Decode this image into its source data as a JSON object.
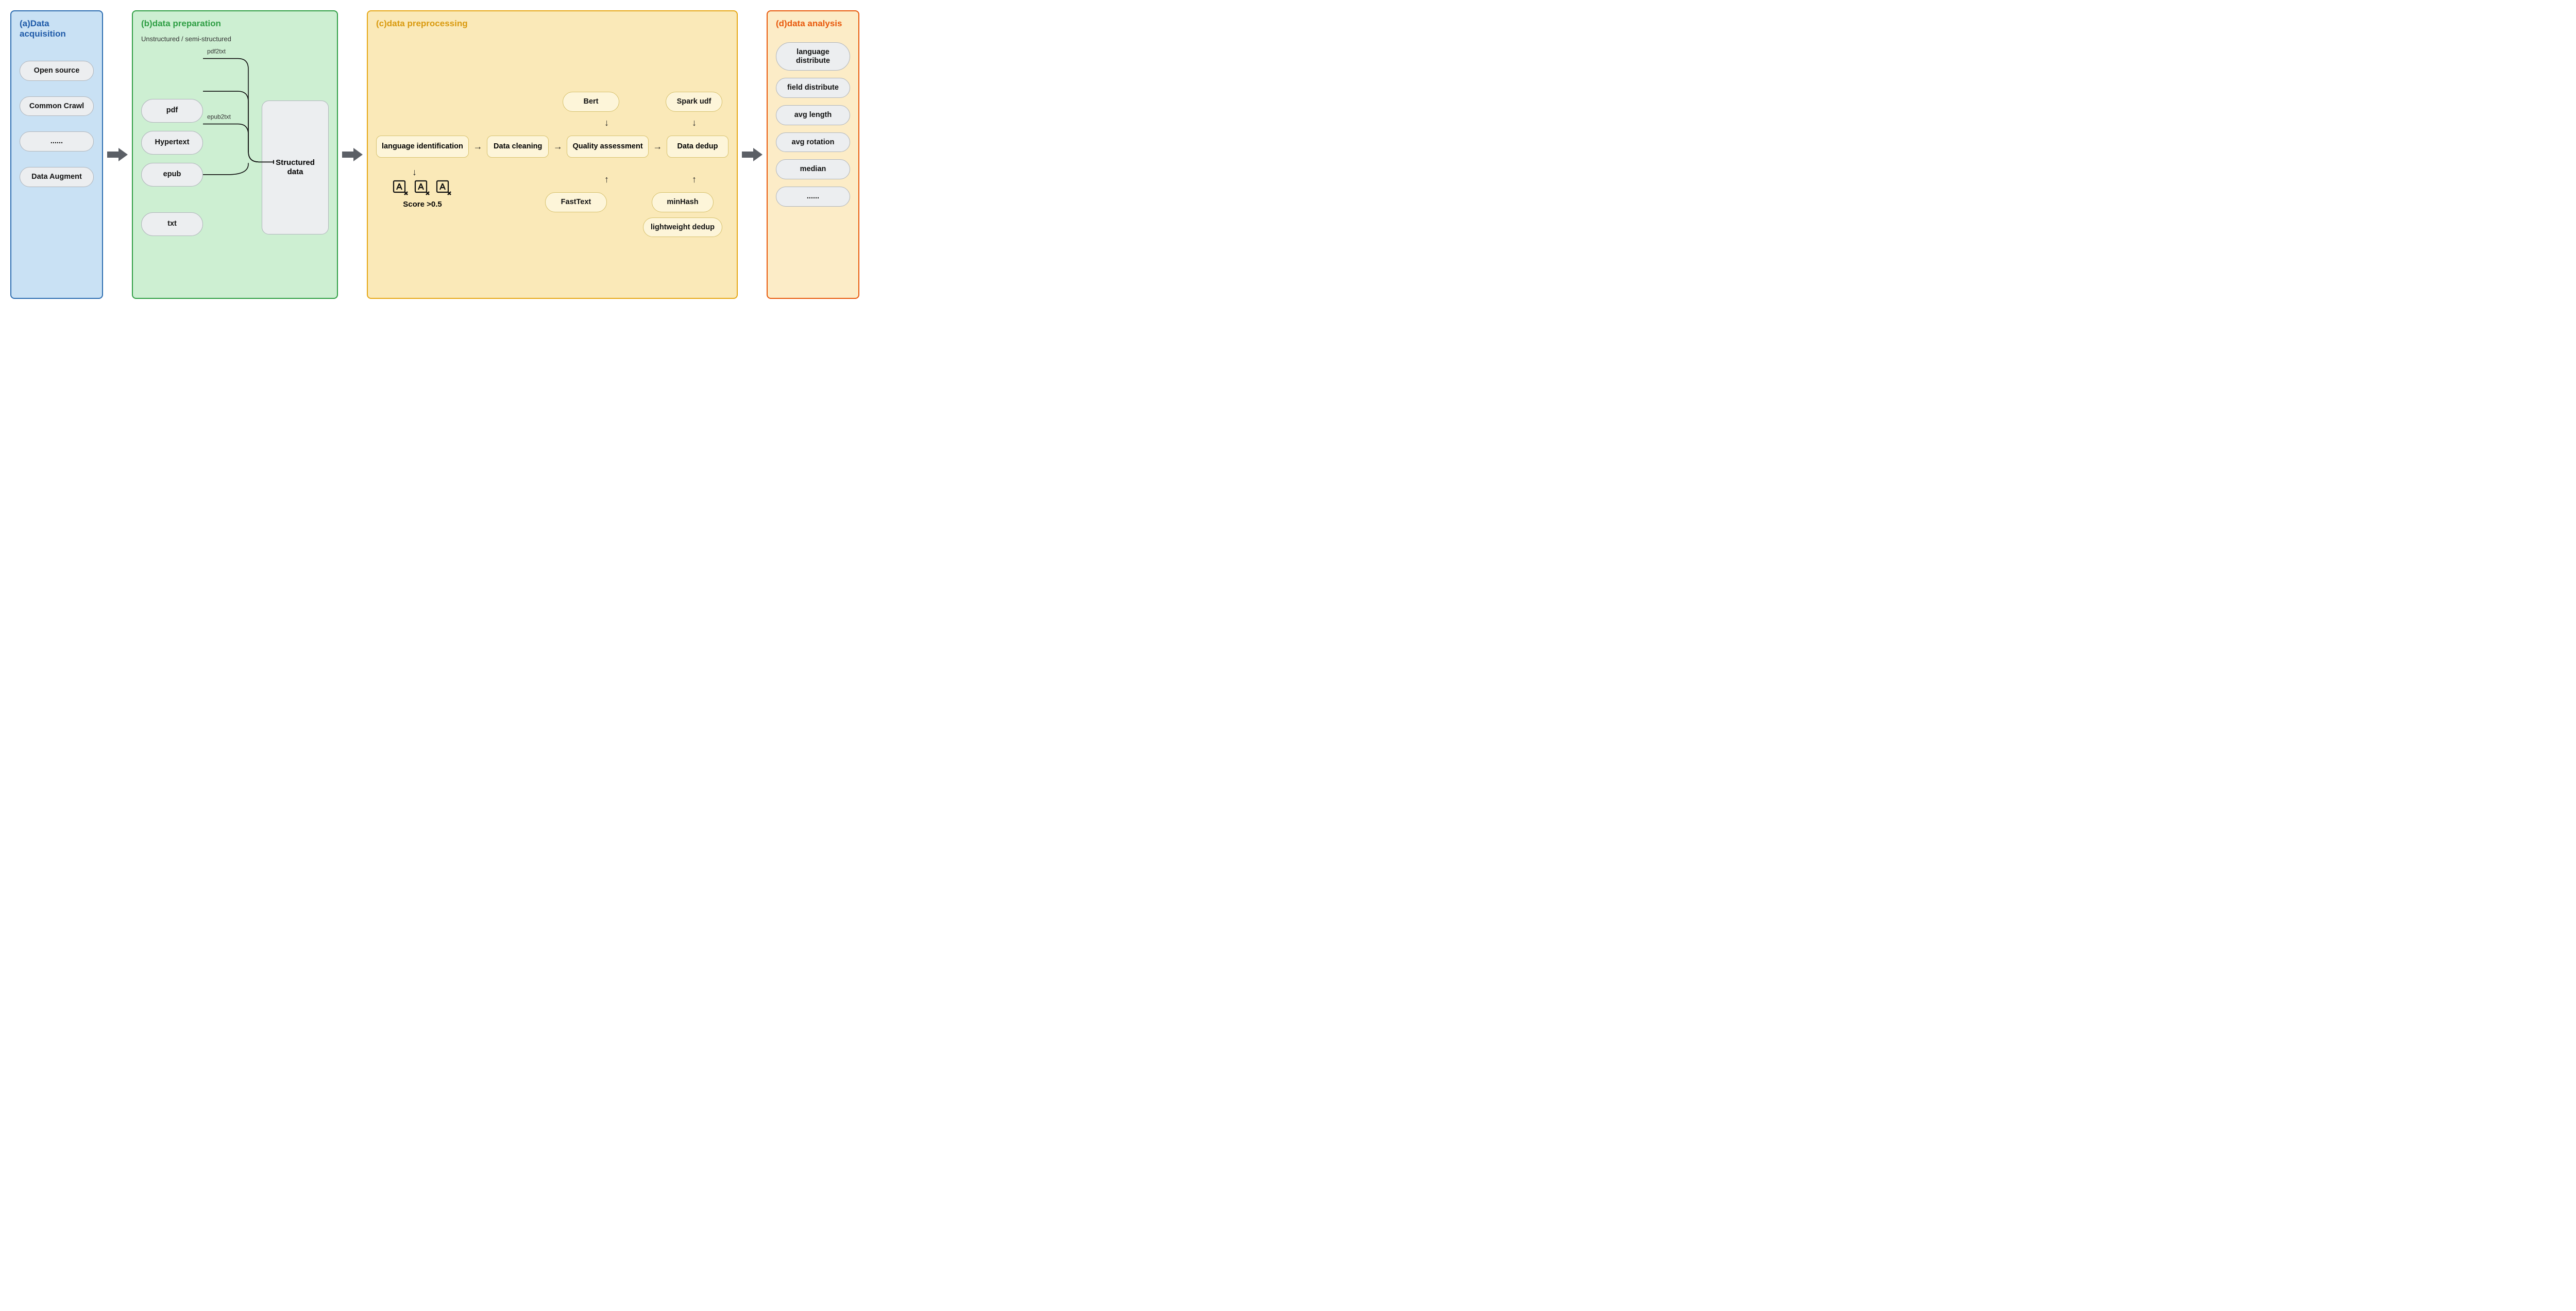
{
  "panels": {
    "a": {
      "title": "(a)Data acquisition",
      "items": [
        "Open source",
        "Common Crawl",
        "......",
        "Data Augment"
      ]
    },
    "b": {
      "title": "(b)data preparation",
      "sub_label": "Unstructured / semi-structured",
      "formats": [
        "pdf",
        "Hypertext",
        "epub",
        "txt"
      ],
      "edge_labels": {
        "pdf": "pdf2txt",
        "epub": "epub2txt"
      },
      "output": "Structured data"
    },
    "c": {
      "title": "(c)data preprocessing",
      "steps": [
        "language identification",
        "Data cleaning",
        "Quality assessment",
        "Data dedup"
      ],
      "quality_inputs_top": [
        "Bert"
      ],
      "quality_inputs_bottom": [
        "FastText"
      ],
      "dedup_inputs_top": [
        "Spark udf"
      ],
      "dedup_inputs_bottom": [
        "minHash",
        "lightweight dedup"
      ],
      "score_label": "Score >0.5"
    },
    "d": {
      "title": "(d)data analysis",
      "metrics": [
        "language distribute",
        "field distribute",
        "avg length",
        "avg rotation",
        "median",
        "......"
      ]
    }
  }
}
